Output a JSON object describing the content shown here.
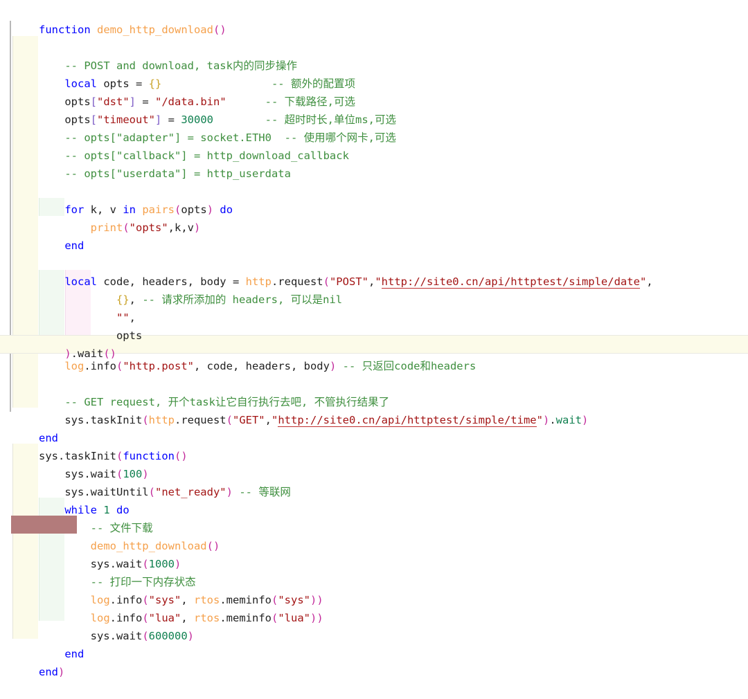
{
  "editor": {
    "language": "Lua",
    "colors": {
      "background": "#ffffff",
      "keyword": "#0000ff",
      "function_name": "#f5a04b",
      "string": "#a31515",
      "comment": "#3f8f3f",
      "number": "#108050",
      "call_paren": "#c2299a",
      "bracket": "#7d5cc6",
      "table_brace": "#c9a227",
      "indent_guide_level1": "#fcfbe9",
      "indent_guide_level2": "#f1f9f1",
      "indent_guide_level3": "#fdf0f8",
      "current_line": "#fcfbe9",
      "selection": "#b37b7b",
      "spell_underline": "#c03030",
      "block_bar": "#b8b8b8"
    },
    "current_line_number": 23,
    "selection_present": true
  },
  "code": {
    "lines": [
      {
        "n": 1,
        "indent": 0,
        "text": "function demo_http_download()"
      },
      {
        "n": 2,
        "indent": 0,
        "text": ""
      },
      {
        "n": 3,
        "indent": 1,
        "text": "-- POST and download, task内的同步操作"
      },
      {
        "n": 4,
        "indent": 1,
        "text": "local opts = {}                 -- 额外的配置项"
      },
      {
        "n": 5,
        "indent": 1,
        "text": "opts[\"dst\"] = \"/data.bin\"        -- 下载路径,可选"
      },
      {
        "n": 6,
        "indent": 1,
        "text": "opts[\"timeout\"] = 30000          -- 超时时长,单位ms,可选"
      },
      {
        "n": 7,
        "indent": 1,
        "text": "-- opts[\"adapter\"] = socket.ETH0  -- 使用哪个网卡,可选"
      },
      {
        "n": 8,
        "indent": 1,
        "text": "-- opts[\"callback\"] = http_download_callback"
      },
      {
        "n": 9,
        "indent": 1,
        "text": "-- opts[\"userdata\"] = http_userdata"
      },
      {
        "n": 10,
        "indent": 1,
        "text": ""
      },
      {
        "n": 11,
        "indent": 1,
        "text": "for k, v in pairs(opts) do"
      },
      {
        "n": 12,
        "indent": 2,
        "text": "print(\"opts\",k,v)"
      },
      {
        "n": 13,
        "indent": 1,
        "text": "end"
      },
      {
        "n": 14,
        "indent": 1,
        "text": ""
      },
      {
        "n": 15,
        "indent": 1,
        "text": "local code, headers, body = http.request(\"POST\",\"http://site0.cn/api/httptest/simple/date\","
      },
      {
        "n": 16,
        "indent": 3,
        "text": "{}, -- 请求所添加的 headers, 可以是nil"
      },
      {
        "n": 17,
        "indent": 3,
        "text": "\"\","
      },
      {
        "n": 18,
        "indent": 3,
        "text": "opts"
      },
      {
        "n": 19,
        "indent": 1,
        "text": ").wait()"
      },
      {
        "n": 20,
        "indent": 1,
        "text": "log.info(\"http.post\", code, headers, body) -- 只返回code和headers"
      },
      {
        "n": 21,
        "indent": 1,
        "text": ""
      },
      {
        "n": 22,
        "indent": 1,
        "text": "-- GET request, 开个task让它自行执行去吧, 不管执行结果了"
      },
      {
        "n": 23,
        "indent": 1,
        "text": "sys.taskInit(http.request(\"GET\",\"http://site0.cn/api/httptest/simple/time\").wait)"
      },
      {
        "n": 24,
        "indent": 0,
        "text": "end"
      },
      {
        "n": 25,
        "indent": 0,
        "text": "sys.taskInit(function()"
      },
      {
        "n": 26,
        "indent": 1,
        "text": "sys.wait(100)"
      },
      {
        "n": 27,
        "indent": 1,
        "text": "sys.waitUntil(\"net_ready\") -- 等联网"
      },
      {
        "n": 28,
        "indent": 1,
        "text": "while 1 do"
      },
      {
        "n": 29,
        "indent": 2,
        "text": "-- 文件下载"
      },
      {
        "n": 30,
        "indent": 2,
        "text": "demo_http_download()"
      },
      {
        "n": 31,
        "indent": 2,
        "text": "sys.wait(1000)"
      },
      {
        "n": 32,
        "indent": 2,
        "text": "-- 打印一下内存状态"
      },
      {
        "n": 33,
        "indent": 2,
        "text": "log.info(\"sys\", rtos.meminfo(\"sys\"))"
      },
      {
        "n": 34,
        "indent": 2,
        "text": "log.info(\"lua\", rtos.meminfo(\"lua\"))"
      },
      {
        "n": 35,
        "indent": 2,
        "text": "sys.wait(600000)"
      },
      {
        "n": 36,
        "indent": 1,
        "text": "end"
      },
      {
        "n": 37,
        "indent": 0,
        "text": "end)"
      }
    ],
    "urls": [
      "http://site0.cn/api/httptest/simple/date",
      "http://site0.cn/api/httptest/simple/time"
    ],
    "comments": [
      "-- POST and download, task内的同步操作",
      "-- 额外的配置项",
      "-- 下载路径,可选",
      "-- 超时时长,单位ms,可选",
      "-- 使用哪个网卡,可选",
      "-- 只返回code和headers",
      "-- GET request, 开个task让它自行执行去吧, 不管执行结果了",
      "-- 等联网",
      "-- 文件下载",
      "-- 打印一下内存状态",
      "-- 请求所添加的 headers, 可以是nil"
    ],
    "identifiers": [
      "demo_http_download",
      "opts",
      "pairs",
      "print",
      "http",
      "request",
      "log",
      "info",
      "sys",
      "taskInit",
      "wait",
      "waitUntil",
      "rtos",
      "meminfo",
      "code",
      "headers",
      "body",
      "k",
      "v",
      "socket",
      "http_download_callback",
      "http_userdata"
    ],
    "strings": [
      "\"dst\"",
      "\"/data.bin\"",
      "\"timeout\"",
      "\"adapter\"",
      "\"callback\"",
      "\"userdata\"",
      "\"opts\"",
      "\"POST\"",
      "\"\"",
      "\"http.post\"",
      "\"GET\"",
      "\"net_ready\"",
      "\"sys\"",
      "\"lua\""
    ],
    "numbers": [
      "30000",
      "100",
      "1",
      "1000",
      "600000"
    ],
    "keywords": [
      "function",
      "local",
      "for",
      "in",
      "do",
      "end",
      "while"
    ]
  }
}
